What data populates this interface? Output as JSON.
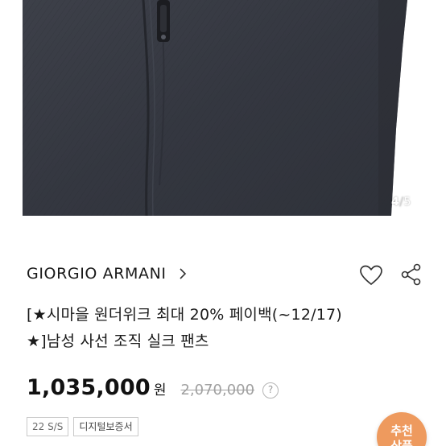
{
  "gallery": {
    "current": "4",
    "separator": "/",
    "total": "5"
  },
  "brand": {
    "name": "GIORGIO ARMANI"
  },
  "product": {
    "title_line1": "[★시마을 원더위크 최대 20% 페이백(~12/17)",
    "title_line2": "★]남성 사선 조직 실크 팬츠"
  },
  "price": {
    "sale": "1,035,000",
    "currency": "원",
    "original": "2,070,000",
    "help": "?"
  },
  "badges": {
    "season": "22 S/S",
    "certificate": "디지털보증서"
  },
  "recommend": {
    "label_line1": "추천",
    "label_line2": "상품"
  },
  "colors": {
    "fabric": "#3a3d46",
    "accent": "#ee9a5e"
  }
}
